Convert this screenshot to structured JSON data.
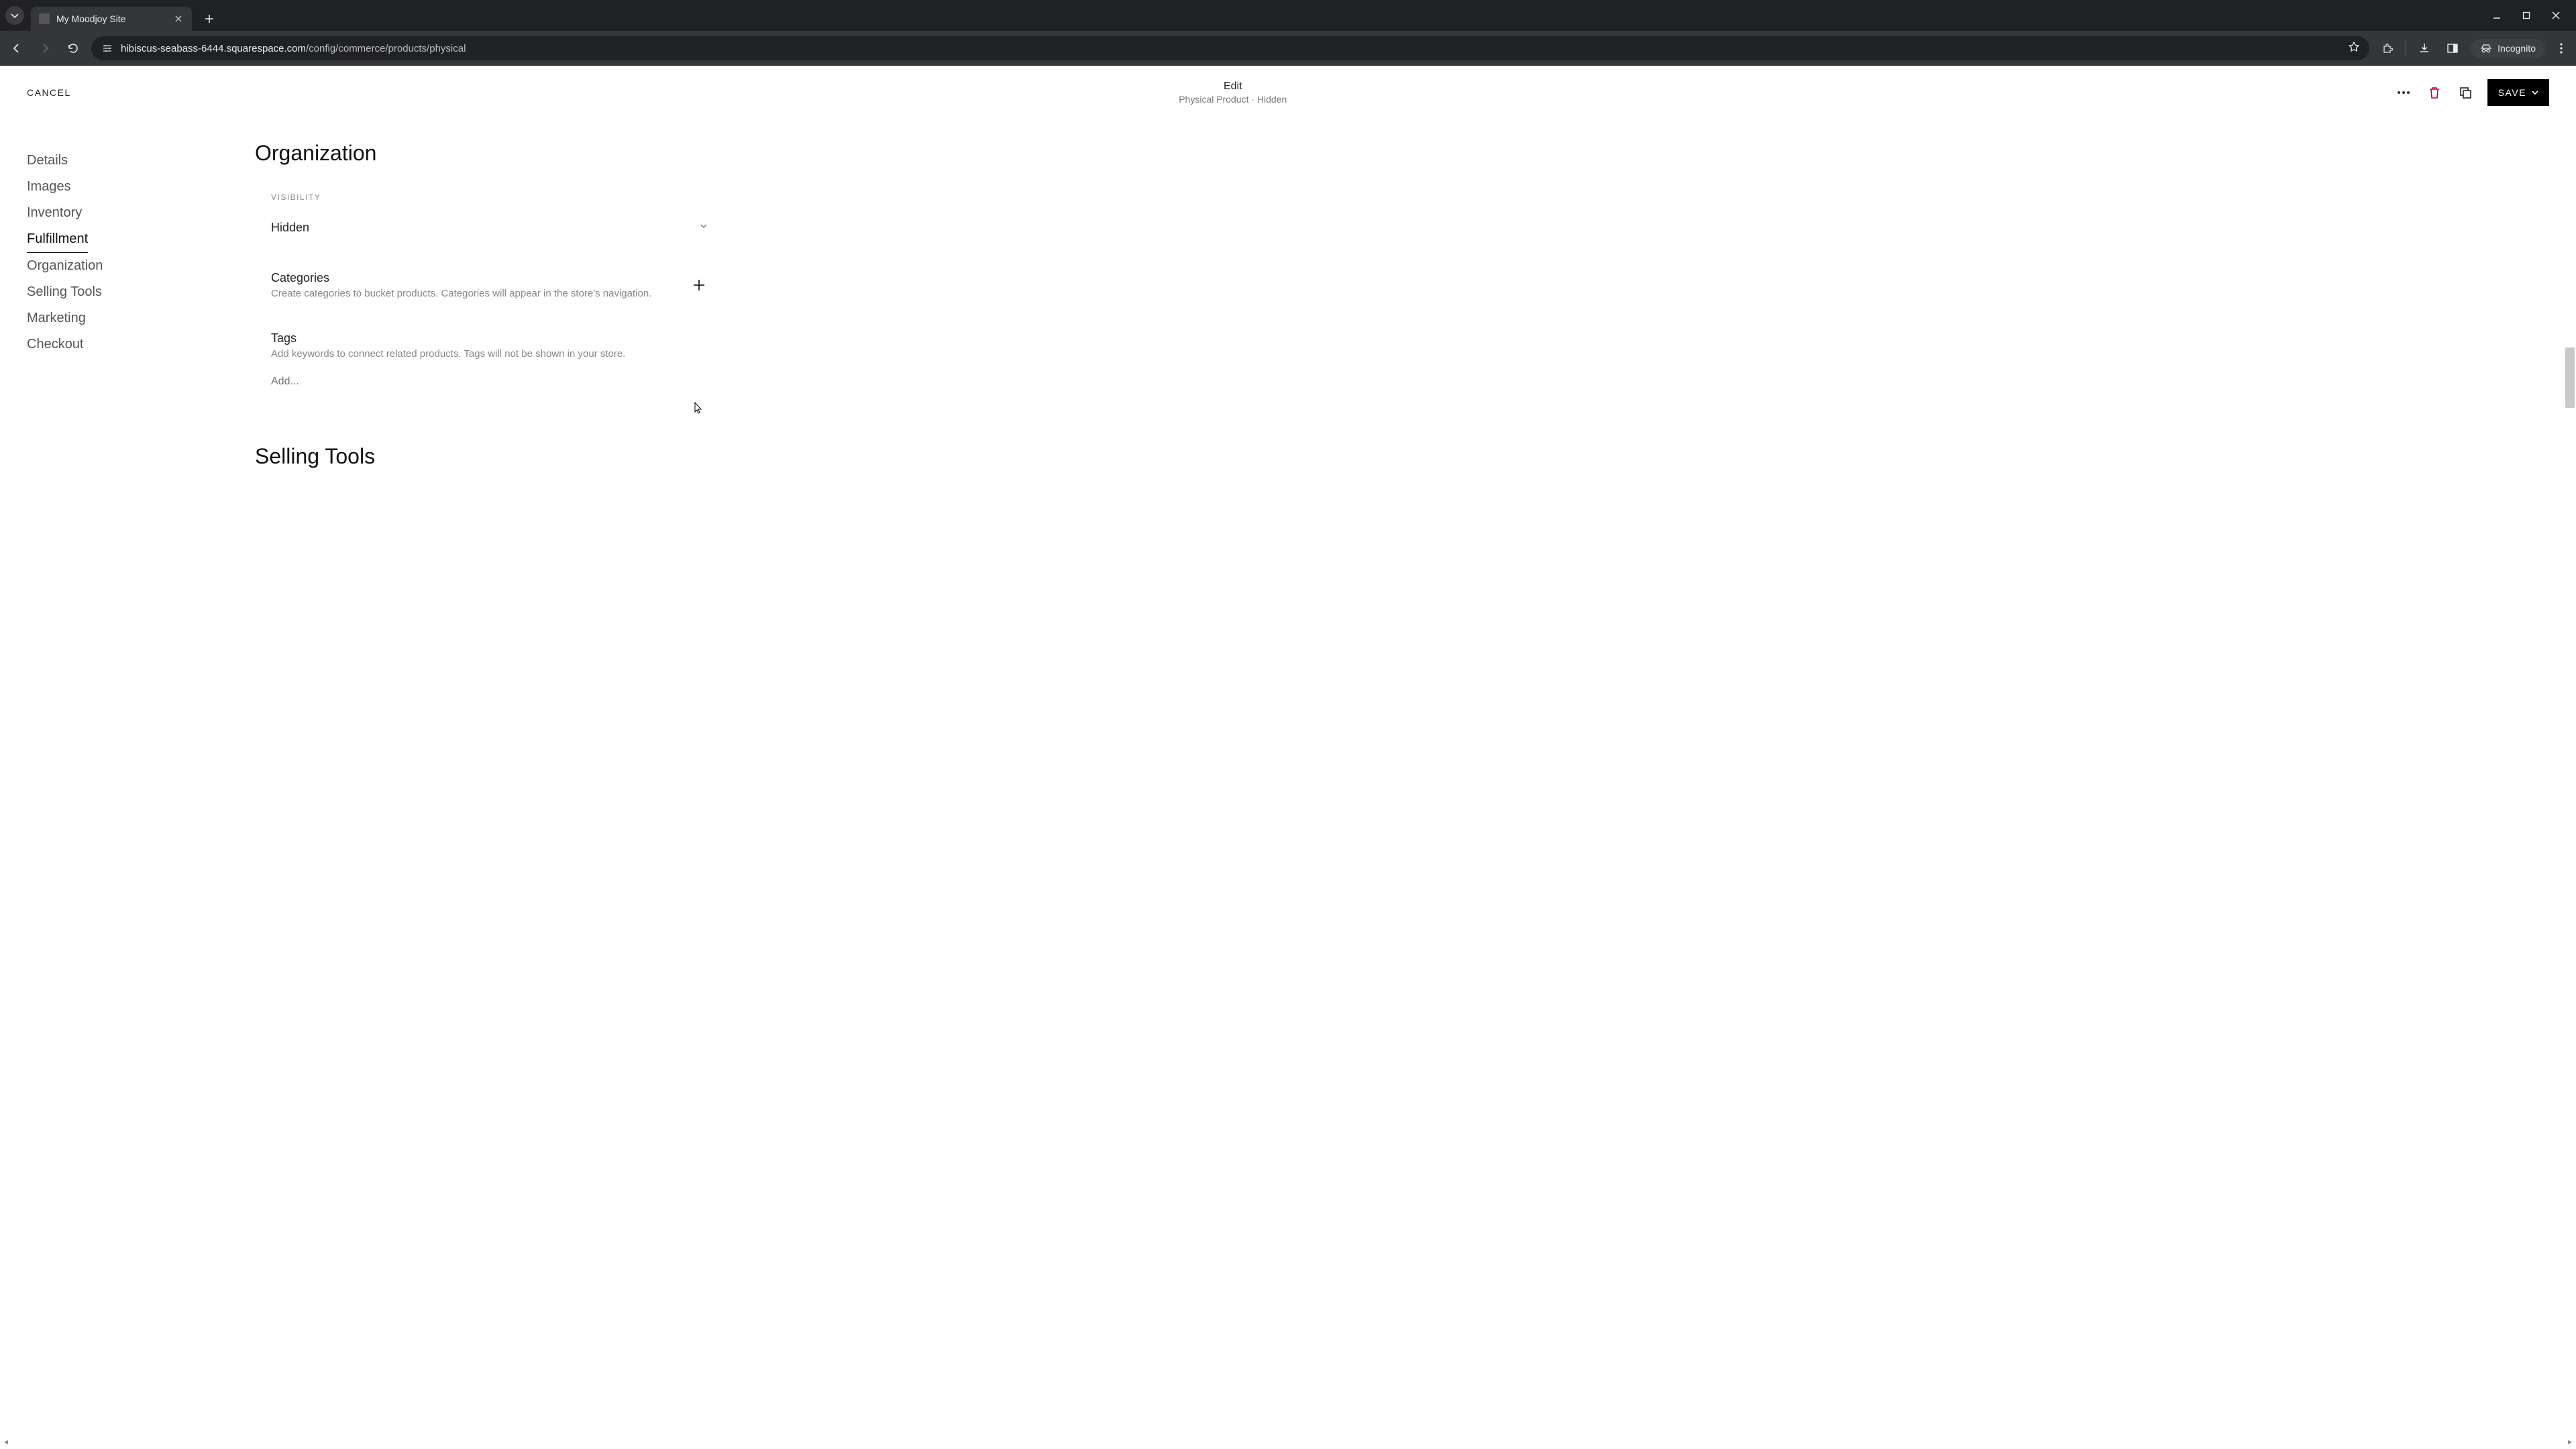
{
  "browser": {
    "tab_title": "My Moodjoy Site",
    "url_host": "hibiscus-seabass-6444.squarespace.com",
    "url_path": "/config/commerce/products/physical",
    "incognito_label": "Incognito"
  },
  "header": {
    "cancel": "CANCEL",
    "title": "Edit",
    "subtitle": "Physical Product · Hidden",
    "save": "SAVE"
  },
  "sidebar": {
    "items": [
      {
        "label": "Details"
      },
      {
        "label": "Images"
      },
      {
        "label": "Inventory"
      },
      {
        "label": "Fulfillment"
      },
      {
        "label": "Organization"
      },
      {
        "label": "Selling Tools"
      },
      {
        "label": "Marketing"
      },
      {
        "label": "Checkout"
      }
    ]
  },
  "main": {
    "organization_title": "Organization",
    "visibility_label": "VISIBILITY",
    "visibility_value": "Hidden",
    "categories_title": "Categories",
    "categories_desc": "Create categories to bucket products. Categories will appear in the store's navigation.",
    "tags_title": "Tags",
    "tags_desc": "Add keywords to connect related products. Tags will not be shown in your store.",
    "tags_placeholder": "Add...",
    "selling_tools_title": "Selling Tools"
  }
}
